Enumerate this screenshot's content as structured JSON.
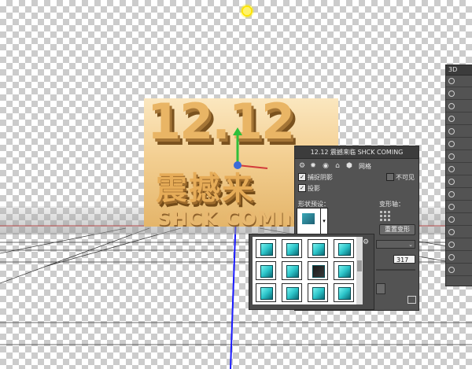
{
  "canvas": {
    "artwork": {
      "number_text": "12.12",
      "chinese_text": "震撼来",
      "english_text": "SHCK COMING",
      "accent_gold": "#e9b565"
    },
    "light_icon": "sun-light-icon",
    "gizmo_icon": "move-axis-gizmo-icon"
  },
  "properties_panel": {
    "title": "12.12 震撼来临  SHCK COMING",
    "toolbar_icons": [
      "scene-icon",
      "light-icon",
      "camera-icon",
      "environment-icon",
      "mesh-icon"
    ],
    "tab_mesh": "网格",
    "catch_shadow_label": "捕捉阴影",
    "catch_shadow_checked": true,
    "invisible_label": "不可见",
    "invisible_checked": false,
    "cast_shadow_label": "投影",
    "cast_shadow_checked": true,
    "shape_preset_label": "形状预设：",
    "deform_axis_label": "变形轴：",
    "reset_deform_label": "重置变形",
    "value_field": "317"
  },
  "preset_picker": {
    "gear_icon": "gear-icon",
    "options_icon": "panel-options-icon",
    "cubes": 12
  },
  "layers_panel": {
    "header": "3D",
    "row_count": 16
  }
}
